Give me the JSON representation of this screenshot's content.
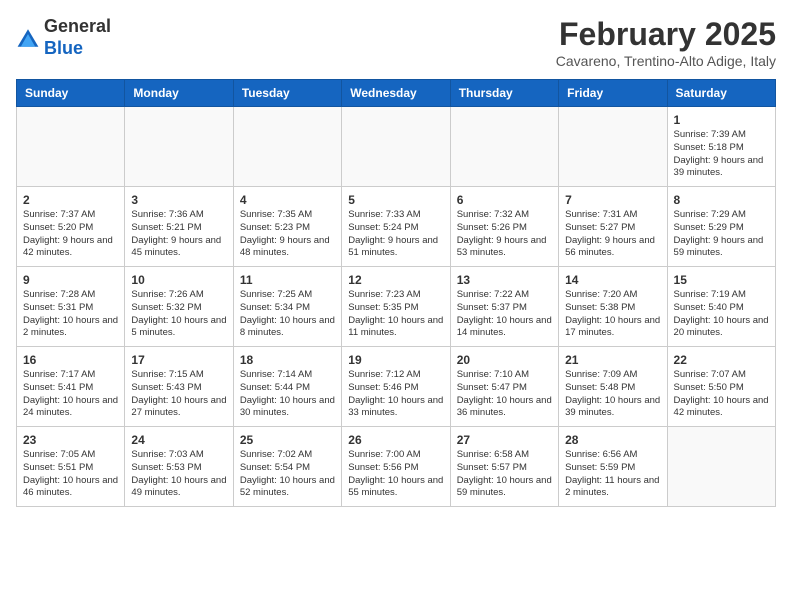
{
  "logo": {
    "general": "General",
    "blue": "Blue"
  },
  "header": {
    "title": "February 2025",
    "subtitle": "Cavareno, Trentino-Alto Adige, Italy"
  },
  "columns": [
    "Sunday",
    "Monday",
    "Tuesday",
    "Wednesday",
    "Thursday",
    "Friday",
    "Saturday"
  ],
  "weeks": [
    [
      {
        "day": "",
        "info": ""
      },
      {
        "day": "",
        "info": ""
      },
      {
        "day": "",
        "info": ""
      },
      {
        "day": "",
        "info": ""
      },
      {
        "day": "",
        "info": ""
      },
      {
        "day": "",
        "info": ""
      },
      {
        "day": "1",
        "info": "Sunrise: 7:39 AM\nSunset: 5:18 PM\nDaylight: 9 hours and 39 minutes."
      }
    ],
    [
      {
        "day": "2",
        "info": "Sunrise: 7:37 AM\nSunset: 5:20 PM\nDaylight: 9 hours and 42 minutes."
      },
      {
        "day": "3",
        "info": "Sunrise: 7:36 AM\nSunset: 5:21 PM\nDaylight: 9 hours and 45 minutes."
      },
      {
        "day": "4",
        "info": "Sunrise: 7:35 AM\nSunset: 5:23 PM\nDaylight: 9 hours and 48 minutes."
      },
      {
        "day": "5",
        "info": "Sunrise: 7:33 AM\nSunset: 5:24 PM\nDaylight: 9 hours and 51 minutes."
      },
      {
        "day": "6",
        "info": "Sunrise: 7:32 AM\nSunset: 5:26 PM\nDaylight: 9 hours and 53 minutes."
      },
      {
        "day": "7",
        "info": "Sunrise: 7:31 AM\nSunset: 5:27 PM\nDaylight: 9 hours and 56 minutes."
      },
      {
        "day": "8",
        "info": "Sunrise: 7:29 AM\nSunset: 5:29 PM\nDaylight: 9 hours and 59 minutes."
      }
    ],
    [
      {
        "day": "9",
        "info": "Sunrise: 7:28 AM\nSunset: 5:31 PM\nDaylight: 10 hours and 2 minutes."
      },
      {
        "day": "10",
        "info": "Sunrise: 7:26 AM\nSunset: 5:32 PM\nDaylight: 10 hours and 5 minutes."
      },
      {
        "day": "11",
        "info": "Sunrise: 7:25 AM\nSunset: 5:34 PM\nDaylight: 10 hours and 8 minutes."
      },
      {
        "day": "12",
        "info": "Sunrise: 7:23 AM\nSunset: 5:35 PM\nDaylight: 10 hours and 11 minutes."
      },
      {
        "day": "13",
        "info": "Sunrise: 7:22 AM\nSunset: 5:37 PM\nDaylight: 10 hours and 14 minutes."
      },
      {
        "day": "14",
        "info": "Sunrise: 7:20 AM\nSunset: 5:38 PM\nDaylight: 10 hours and 17 minutes."
      },
      {
        "day": "15",
        "info": "Sunrise: 7:19 AM\nSunset: 5:40 PM\nDaylight: 10 hours and 20 minutes."
      }
    ],
    [
      {
        "day": "16",
        "info": "Sunrise: 7:17 AM\nSunset: 5:41 PM\nDaylight: 10 hours and 24 minutes."
      },
      {
        "day": "17",
        "info": "Sunrise: 7:15 AM\nSunset: 5:43 PM\nDaylight: 10 hours and 27 minutes."
      },
      {
        "day": "18",
        "info": "Sunrise: 7:14 AM\nSunset: 5:44 PM\nDaylight: 10 hours and 30 minutes."
      },
      {
        "day": "19",
        "info": "Sunrise: 7:12 AM\nSunset: 5:46 PM\nDaylight: 10 hours and 33 minutes."
      },
      {
        "day": "20",
        "info": "Sunrise: 7:10 AM\nSunset: 5:47 PM\nDaylight: 10 hours and 36 minutes."
      },
      {
        "day": "21",
        "info": "Sunrise: 7:09 AM\nSunset: 5:48 PM\nDaylight: 10 hours and 39 minutes."
      },
      {
        "day": "22",
        "info": "Sunrise: 7:07 AM\nSunset: 5:50 PM\nDaylight: 10 hours and 42 minutes."
      }
    ],
    [
      {
        "day": "23",
        "info": "Sunrise: 7:05 AM\nSunset: 5:51 PM\nDaylight: 10 hours and 46 minutes."
      },
      {
        "day": "24",
        "info": "Sunrise: 7:03 AM\nSunset: 5:53 PM\nDaylight: 10 hours and 49 minutes."
      },
      {
        "day": "25",
        "info": "Sunrise: 7:02 AM\nSunset: 5:54 PM\nDaylight: 10 hours and 52 minutes."
      },
      {
        "day": "26",
        "info": "Sunrise: 7:00 AM\nSunset: 5:56 PM\nDaylight: 10 hours and 55 minutes."
      },
      {
        "day": "27",
        "info": "Sunrise: 6:58 AM\nSunset: 5:57 PM\nDaylight: 10 hours and 59 minutes."
      },
      {
        "day": "28",
        "info": "Sunrise: 6:56 AM\nSunset: 5:59 PM\nDaylight: 11 hours and 2 minutes."
      },
      {
        "day": "",
        "info": ""
      }
    ]
  ]
}
